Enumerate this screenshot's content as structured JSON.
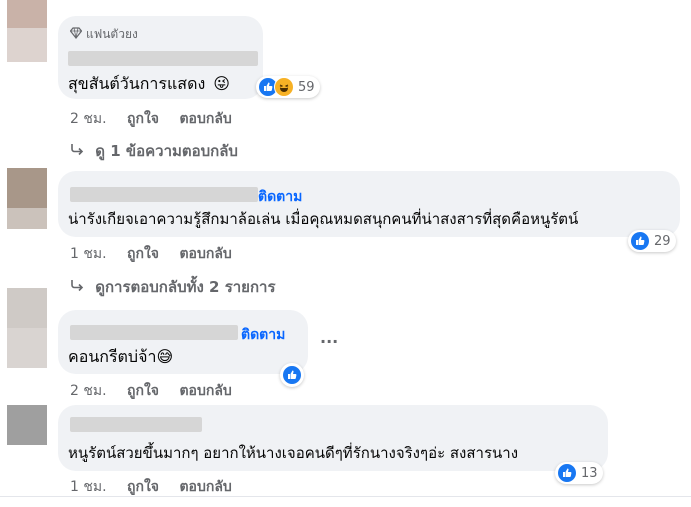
{
  "comments": [
    {
      "badge": "แฟนตัวยง",
      "text": "สุขสันต์วันการแสดง",
      "emoji": "😜",
      "reactions": "59",
      "time": "2 ชม.",
      "like_label": "ถูกใจ",
      "reply_label": "ตอบกลับ",
      "view_replies": "ดู 1 ข้อความตอบกลับ"
    },
    {
      "follow": "ติดตาม",
      "text": "น่ารังเกียจเอาความรู้สึกมาล้อเล่น เมื่อคุณหมดสนุกคนที่น่าสงสารที่สุดคือหนูรัตน์",
      "reactions": "29",
      "time": "1 ชม.",
      "like_label": "ถูกใจ",
      "reply_label": "ตอบกลับ",
      "view_replies": "ดูการตอบกลับทั้ง 2 รายการ"
    },
    {
      "follow": "ติดตาม",
      "text": "คอนกรีตบ่จ้า",
      "emoji": "😅",
      "time": "2 ชม.",
      "like_label": "ถูกใจ",
      "reply_label": "ตอบกลับ",
      "more": "···"
    },
    {
      "text": "หนูรัตน์สวยขึ้นมากๆ อยากให้นางเจอคนดีๆที่รักนางจริงๆอ่ะ สงสารนาง",
      "reactions": "13",
      "time": "1 ชม.",
      "like_label": "ถูกใจ",
      "reply_label": "ตอบกลับ"
    }
  ],
  "icons": {
    "like": "like-reaction-icon",
    "haha": "haha-reaction-icon",
    "diamond": "diamond-icon",
    "reply_arrow": "reply-arrow-icon"
  },
  "colors": {
    "bubble": "#f0f2f5",
    "link": "#0866ff",
    "meta": "#65676b",
    "like": "#1877f2"
  }
}
